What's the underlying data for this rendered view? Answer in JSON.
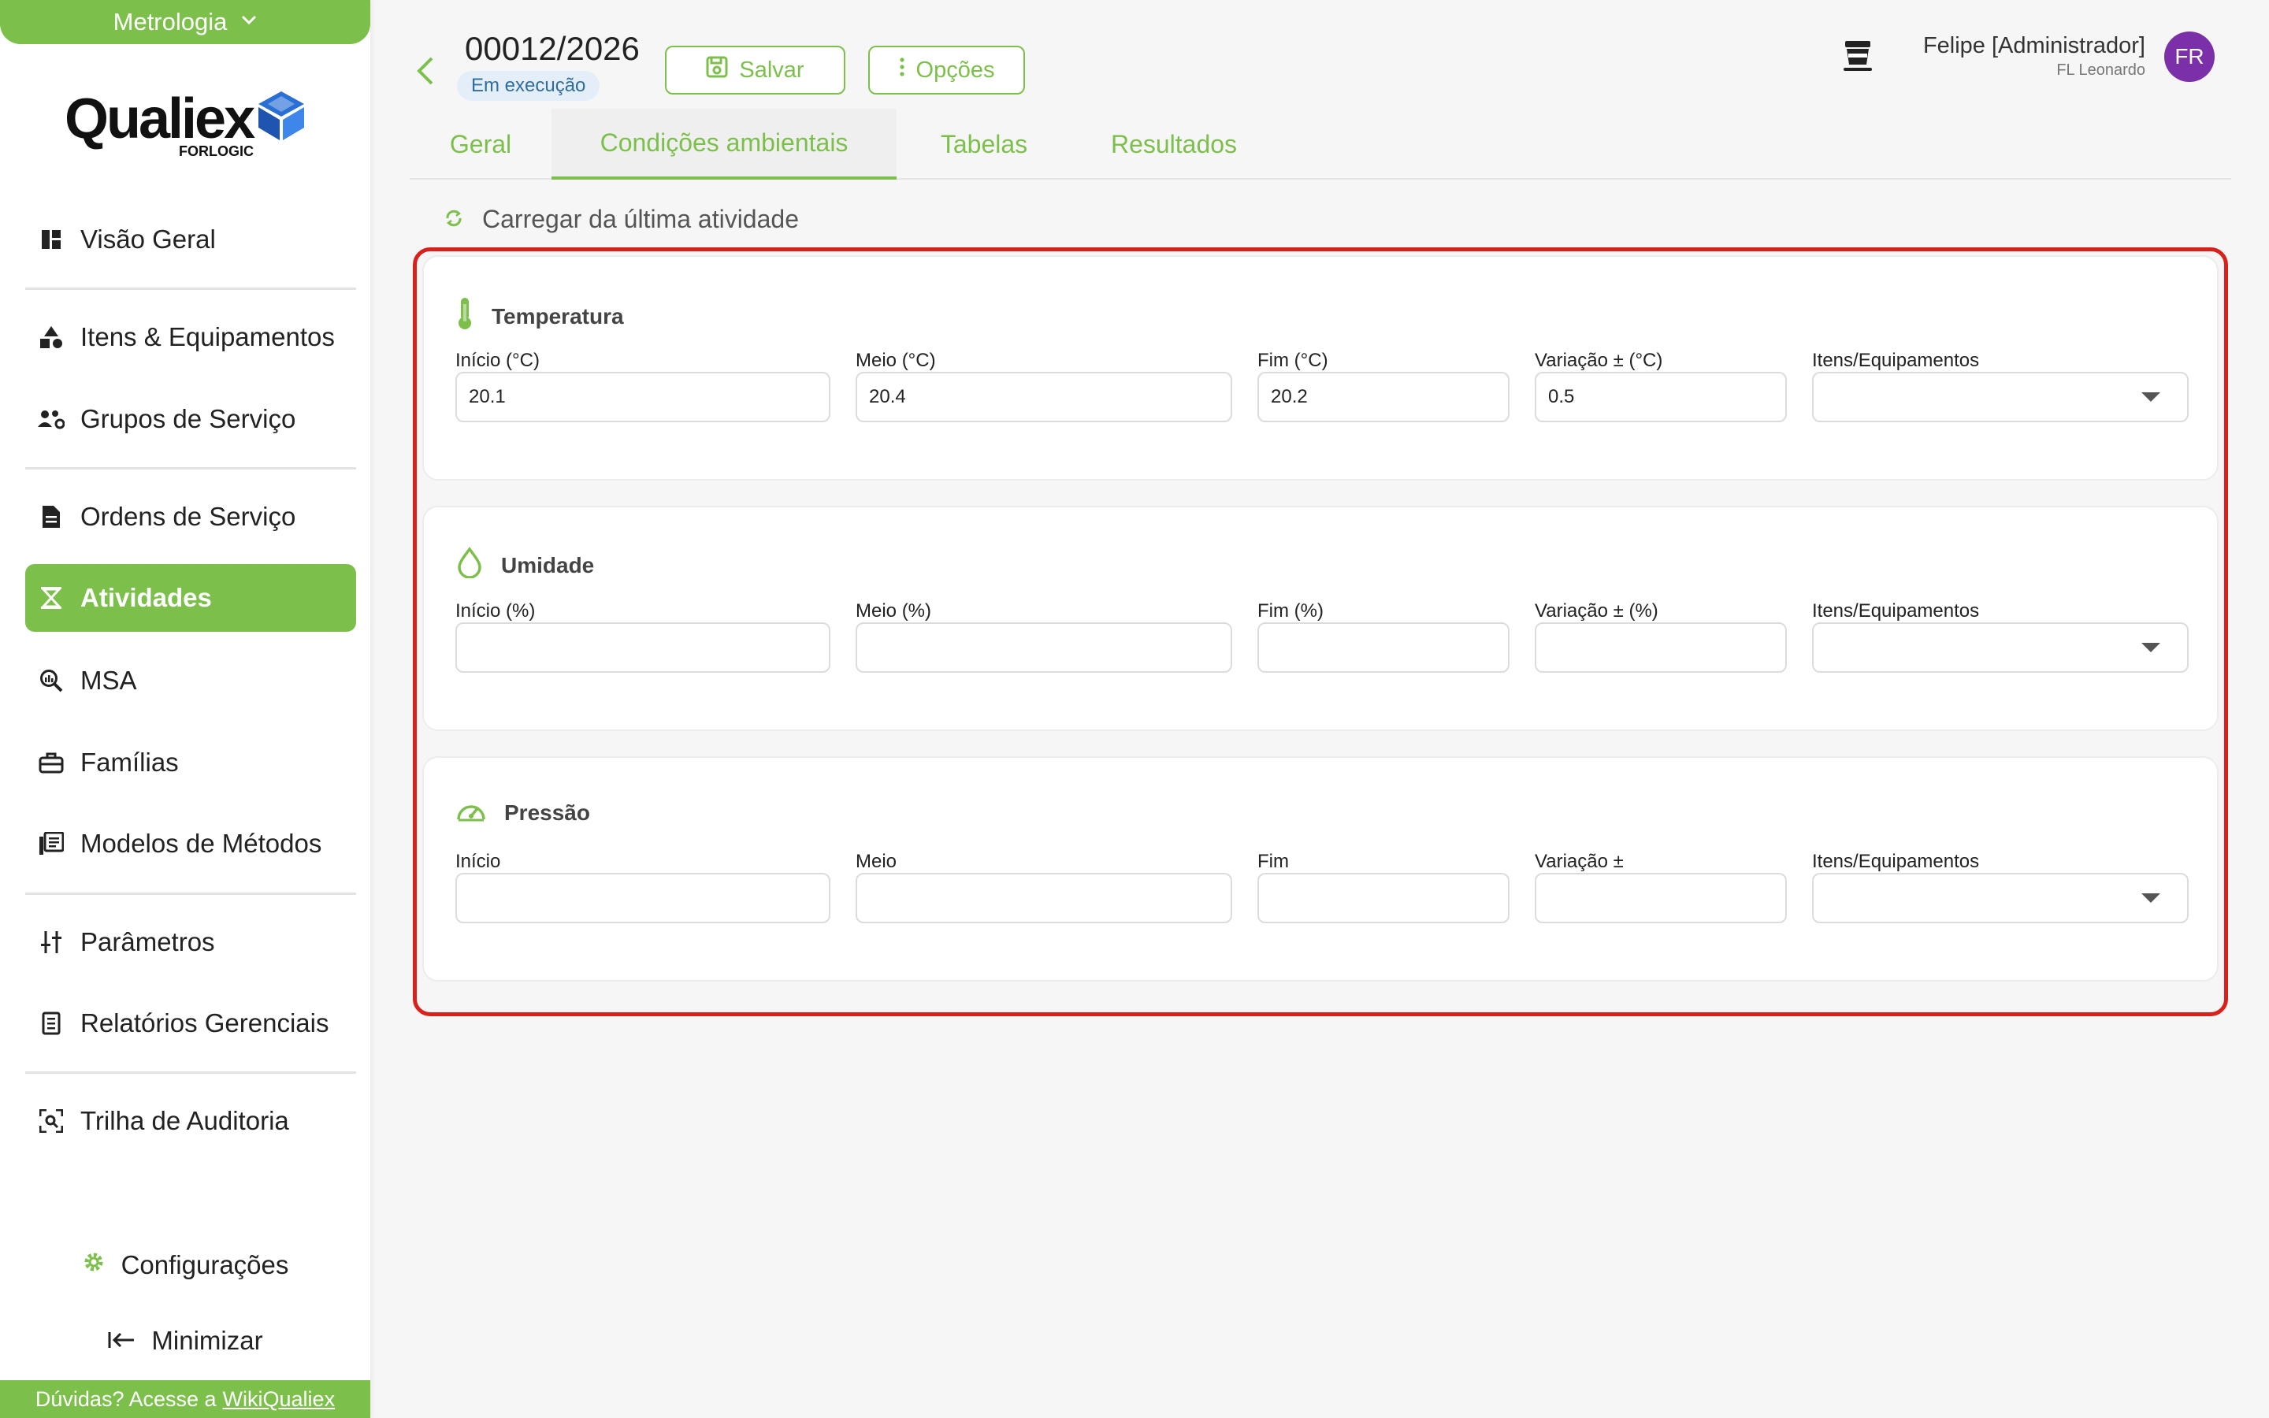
{
  "sidebar": {
    "module": "Metrologia",
    "logo": {
      "word": "Qualiex",
      "sub": "FORLOGIC"
    },
    "items": [
      {
        "label": "Visão Geral",
        "icon": "dashboard-icon"
      },
      {
        "label": "Itens & Equipamentos",
        "icon": "shapes-icon"
      },
      {
        "label": "Grupos de Serviço",
        "icon": "users-gear-icon"
      },
      {
        "label": "Ordens de Serviço",
        "icon": "document-icon"
      },
      {
        "label": "Atividades",
        "icon": "hourglass-icon"
      },
      {
        "label": "MSA",
        "icon": "magnifier-chart-icon"
      },
      {
        "label": "Famílias",
        "icon": "toolbox-icon"
      },
      {
        "label": "Modelos de Métodos",
        "icon": "books-icon"
      },
      {
        "label": "Parâmetros",
        "icon": "sliders-icon"
      },
      {
        "label": "Relatórios Gerenciais",
        "icon": "report-icon"
      },
      {
        "label": "Trilha de Auditoria",
        "icon": "audit-scan-icon"
      }
    ],
    "settings_label": "Configurações",
    "minimize_label": "Minimizar",
    "help_text": "Dúvidas? Acesse a",
    "help_link": "WikiQualiex"
  },
  "header": {
    "number": "00012/2026",
    "status": "Em execução",
    "save_label": "Salvar",
    "options_label": "Opções",
    "user_name": "Felipe [Administrador]",
    "user_org": "FL Leonardo",
    "avatar_initials": "FR"
  },
  "tabs": [
    {
      "label": "Geral",
      "active": false
    },
    {
      "label": "Condições ambientais",
      "active": true
    },
    {
      "label": "Tabelas",
      "active": false
    },
    {
      "label": "Resultados",
      "active": false
    }
  ],
  "load_last_label": "Carregar da última atividade",
  "sections": [
    {
      "title": "Temperatura",
      "icon": "thermometer-icon",
      "fields": [
        {
          "label": "Início (°C)",
          "value": "20.1"
        },
        {
          "label": "Meio (°C)",
          "value": "20.4"
        },
        {
          "label": "Fim (°C)",
          "value": "20.2"
        },
        {
          "label": "Variação ± (°C)",
          "value": "0.5"
        }
      ],
      "select_label": "Itens/Equipamentos",
      "select_value": ""
    },
    {
      "title": "Umidade",
      "icon": "droplet-icon",
      "fields": [
        {
          "label": "Início (%)",
          "value": ""
        },
        {
          "label": "Meio (%)",
          "value": ""
        },
        {
          "label": "Fim (%)",
          "value": ""
        },
        {
          "label": "Variação ± (%)",
          "value": ""
        }
      ],
      "select_label": "Itens/Equipamentos",
      "select_value": ""
    },
    {
      "title": "Pressão",
      "icon": "gauge-icon",
      "fields": [
        {
          "label": "Início",
          "value": ""
        },
        {
          "label": "Meio",
          "value": ""
        },
        {
          "label": "Fim",
          "value": ""
        },
        {
          "label": "Variação ±",
          "value": ""
        }
      ],
      "select_label": "Itens/Equipamentos",
      "select_value": ""
    }
  ],
  "colors": {
    "brand_green": "#7cc04b",
    "highlight_red": "#d9211b",
    "avatar_purple": "#7b2fa8",
    "badge_blue": "#2f6d9c"
  }
}
